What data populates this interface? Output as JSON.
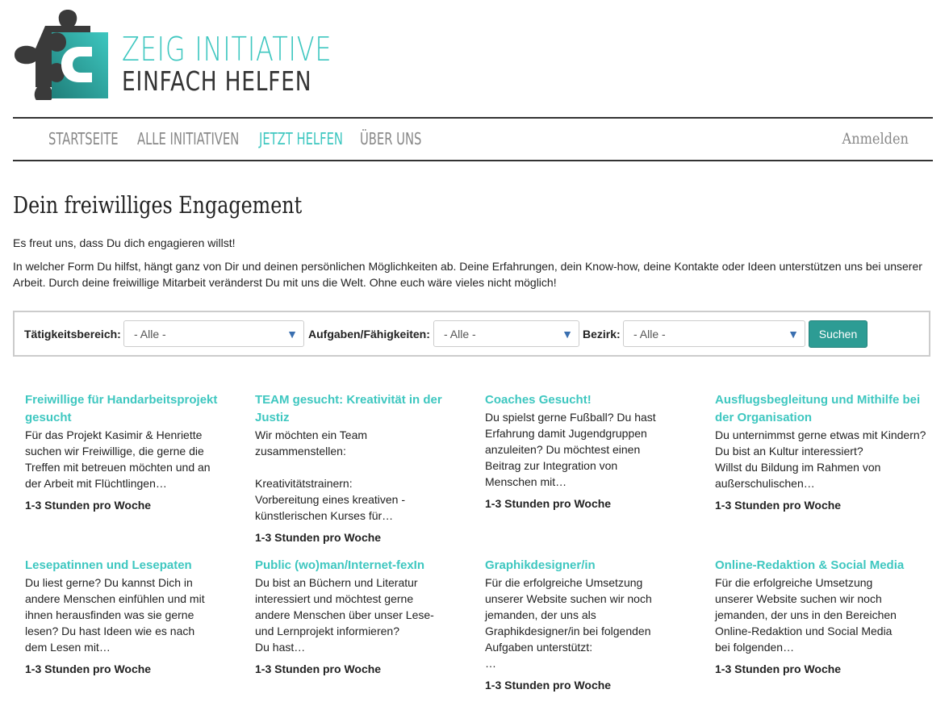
{
  "brand": {
    "line1": "ZEIG INITIATIVE",
    "line2": "EINFACH HELFEN",
    "colors": {
      "accent": "#3ec7c0",
      "dark": "#333333",
      "button": "#2d9c94"
    }
  },
  "nav": {
    "items": [
      {
        "label": "STARTSEITE"
      },
      {
        "label": "ALLE INITIATIVEN"
      },
      {
        "label": "JETZT HELFEN",
        "active": true
      },
      {
        "label": "ÜBER UNS"
      }
    ],
    "login": "Anmelden"
  },
  "page": {
    "title": "Dein freiwilliges Engagement",
    "intro1": "Es freut uns, dass Du dich engagieren willst!",
    "intro2": "In welcher Form Du hilfst, hängt ganz von Dir und deinen persönlichen Möglichkeiten ab. Deine Erfahrungen, dein Know-how, deine Kontakte oder Ideen unterstützen uns bei unserer Arbeit. Durch deine freiwillige Mitarbeit veränderst Du mit uns die Welt. Ohne euch wäre vieles nicht möglich!"
  },
  "filter": {
    "area_label": "Tätigkeitsbereich:",
    "area_value": "- Alle -",
    "skills_label": "Aufgaben/Fähigkeiten:",
    "skills_value": "- Alle -",
    "district_label": "Bezirk:",
    "district_value": "- Alle -",
    "search_label": "Suchen"
  },
  "cards": [
    {
      "title": "Freiwillige für Handarbeitsprojekt gesucht",
      "desc": "Für das Projekt Kasimir & Henriette suchen wir Freiwillige, die gerne die Treffen mit betreuen möchten und an der Arbeit mit Flüchtlingen…",
      "time": "1-3 Stunden pro Woche"
    },
    {
      "title": "TEAM gesucht: Kreativität in der Justiz",
      "desc": "Wir möchten ein Team zusammenstellen:\n\nKreativitätstrainern:\nVorbereitung eines kreativen - künstlerischen Kurses für…",
      "time": "1-3 Stunden pro Woche"
    },
    {
      "title": "Coaches Gesucht!",
      "desc": "Du spielst gerne Fußball? Du hast Erfahrung damit Jugendgruppen anzuleiten? Du möchtest einen Beitrag zur Integration von Menschen mit…",
      "time": "1-3 Stunden pro Woche"
    },
    {
      "title": "Ausflugsbegleitung und Mithilfe bei der Organisation",
      "desc": "Du unternimmst gerne etwas mit Kindern?\nDu bist an Kultur interessiert?\nWillst du Bildung im Rahmen von außerschulischen…",
      "time": "1-3 Stunden pro Woche"
    },
    {
      "title": "Lesepatinnen und Lesepaten",
      "desc": "Du liest gerne? Du kannst Dich in andere Menschen einfühlen und mit ihnen herausfinden was sie gerne lesen? Du hast Ideen wie es nach dem Lesen mit…",
      "time": "1-3 Stunden pro Woche"
    },
    {
      "title": "Public (wo)man/Internet-fexIn",
      "desc": "Du bist an Büchern und Literatur interessiert und möchtest gerne andere Menschen über unser Lese- und Lernprojekt informieren?\nDu hast…",
      "time": "1-3 Stunden pro Woche"
    },
    {
      "title": "Graphikdesigner/in",
      "desc": "Für die erfolgreiche Umsetzung unserer Website suchen wir noch jemanden, der uns als Graphikdesigner/in bei folgenden Aufgaben unterstützt:\n…",
      "time": "1-3 Stunden pro Woche"
    },
    {
      "title": "Online-Redaktion & Social Media",
      "desc": "Für die erfolgreiche Umsetzung unserer Website suchen wir noch jemanden, der uns in den Bereichen Online-Redaktion und Social Media bei folgenden…",
      "time": "1-3 Stunden pro Woche"
    }
  ]
}
